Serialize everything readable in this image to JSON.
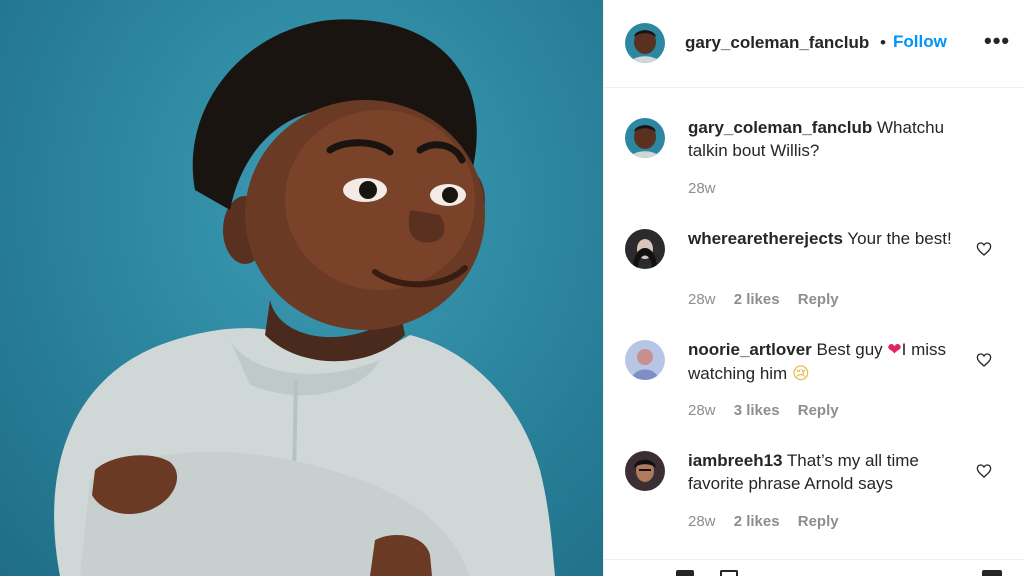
{
  "post": {
    "username": "gary_coleman_fanclub",
    "separator": "•",
    "follow_label": "Follow",
    "more_icon": "more-options-icon"
  },
  "caption": {
    "username": "gary_coleman_fanclub",
    "text": "Whatchu talkin bout Willis?",
    "time": "28w"
  },
  "comments": [
    {
      "username": "wherearetherejects",
      "text": "Your the best!",
      "time": "28w",
      "likes": "2 likes",
      "reply": "Reply"
    },
    {
      "username": "noorie_artlover",
      "text_before": "Best guy ",
      "emoji1": "❤",
      "text_middle": "I miss watching him ",
      "emoji2": "😢",
      "time": "28w",
      "likes": "3 likes",
      "reply": "Reply"
    },
    {
      "username": "iambreeh13",
      "text": "That’s my all time favorite phrase Arnold says",
      "time": "28w",
      "likes": "2 likes",
      "reply": "Reply"
    }
  ],
  "colors": {
    "accent": "#0095f6",
    "photo_background": "#2d87a0",
    "text": "#262626",
    "muted": "#8e8e8e"
  }
}
